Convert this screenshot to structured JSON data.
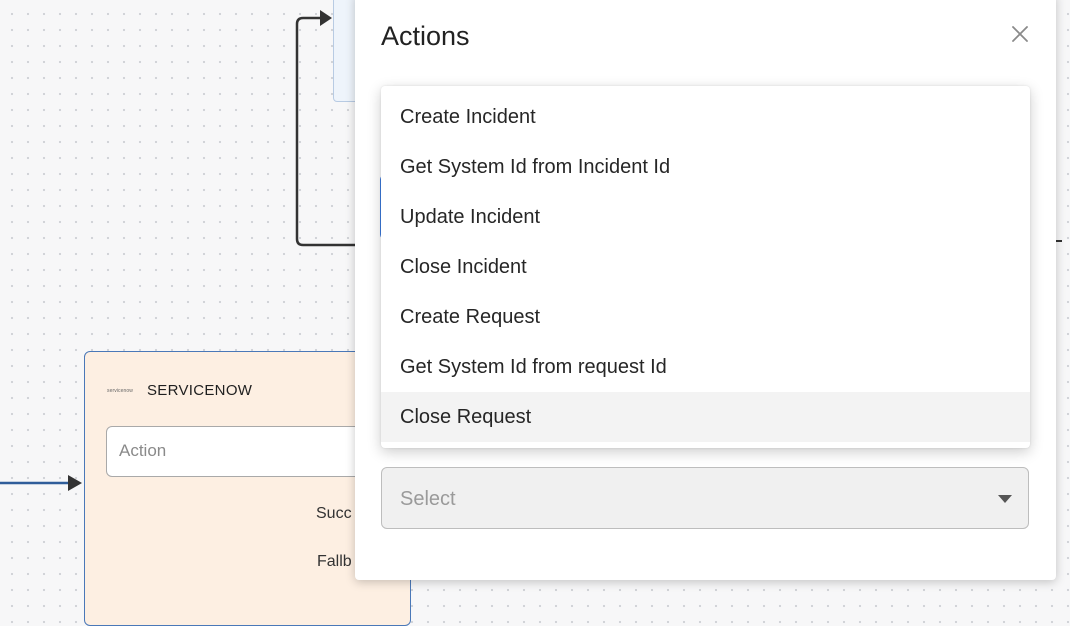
{
  "canvas": {
    "node": {
      "logo_text": "servicenow",
      "title": "SERVICENOW",
      "action_placeholder": "Action",
      "outputs": [
        "Succ",
        "Fallb"
      ]
    }
  },
  "modal": {
    "title": "Actions",
    "close_icon": "close-icon",
    "select_placeholder": "Select"
  },
  "dropdown": {
    "options": [
      "Create Incident",
      "Get System Id from Incident Id",
      "Update Incident",
      "Close Incident",
      "Create Request",
      "Get System Id from request Id",
      "Close Request"
    ],
    "highlighted": "Close Request"
  }
}
